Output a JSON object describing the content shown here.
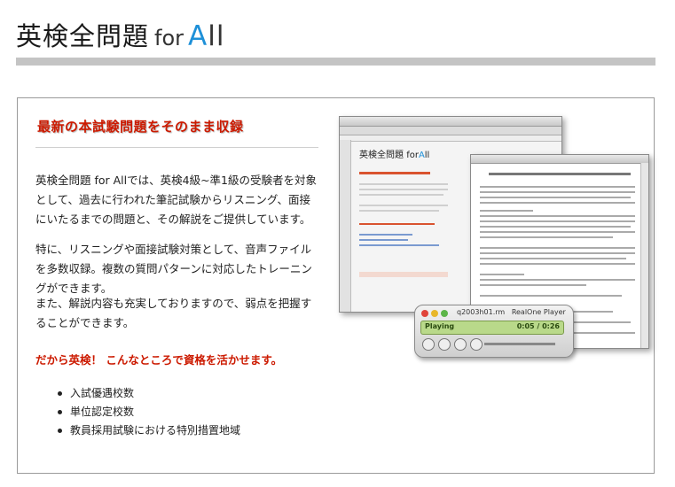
{
  "header": {
    "title_jp": "英検全問題",
    "title_for": "for",
    "title_all_first": "A",
    "title_all_rest": "ll"
  },
  "panel": {
    "heading": "最新の本試験問題をそのまま収録",
    "paragraph1": "英検全問題 for Allでは、英検4級~準1級の受験者を対象として、過去に行われた筆記試験からリスニング、面接にいたるまでの問題と、その解説をご提供しています。",
    "paragraph2": "特に、リスニングや面接試験対策として、音声ファイルを多数収録。複数の質問パターンに対応したトレーニングができます。",
    "paragraph3": "また、解説内容も充実しておりますので、弱点を把握することができます。",
    "emphasis": "だから英検！ こんなところで資格を活かせます。",
    "bullets": [
      "入試優遇校数",
      "単位認定校数",
      "教員採用試験における特別措置地域"
    ]
  },
  "screenshot": {
    "browser_logo_jp": "英検全問題",
    "browser_logo_for": "for",
    "browser_logo_a": "A",
    "browser_logo_ll": "ll",
    "player_title": "q2003h01.rm",
    "player_brand": "RealOne Player",
    "player_status": "Playing",
    "player_time": "0:05 / 0:26"
  },
  "colors": {
    "accent_red": "#cc1a00",
    "accent_blue": "#1e90d8",
    "header_bar": "#c4c4c4"
  }
}
